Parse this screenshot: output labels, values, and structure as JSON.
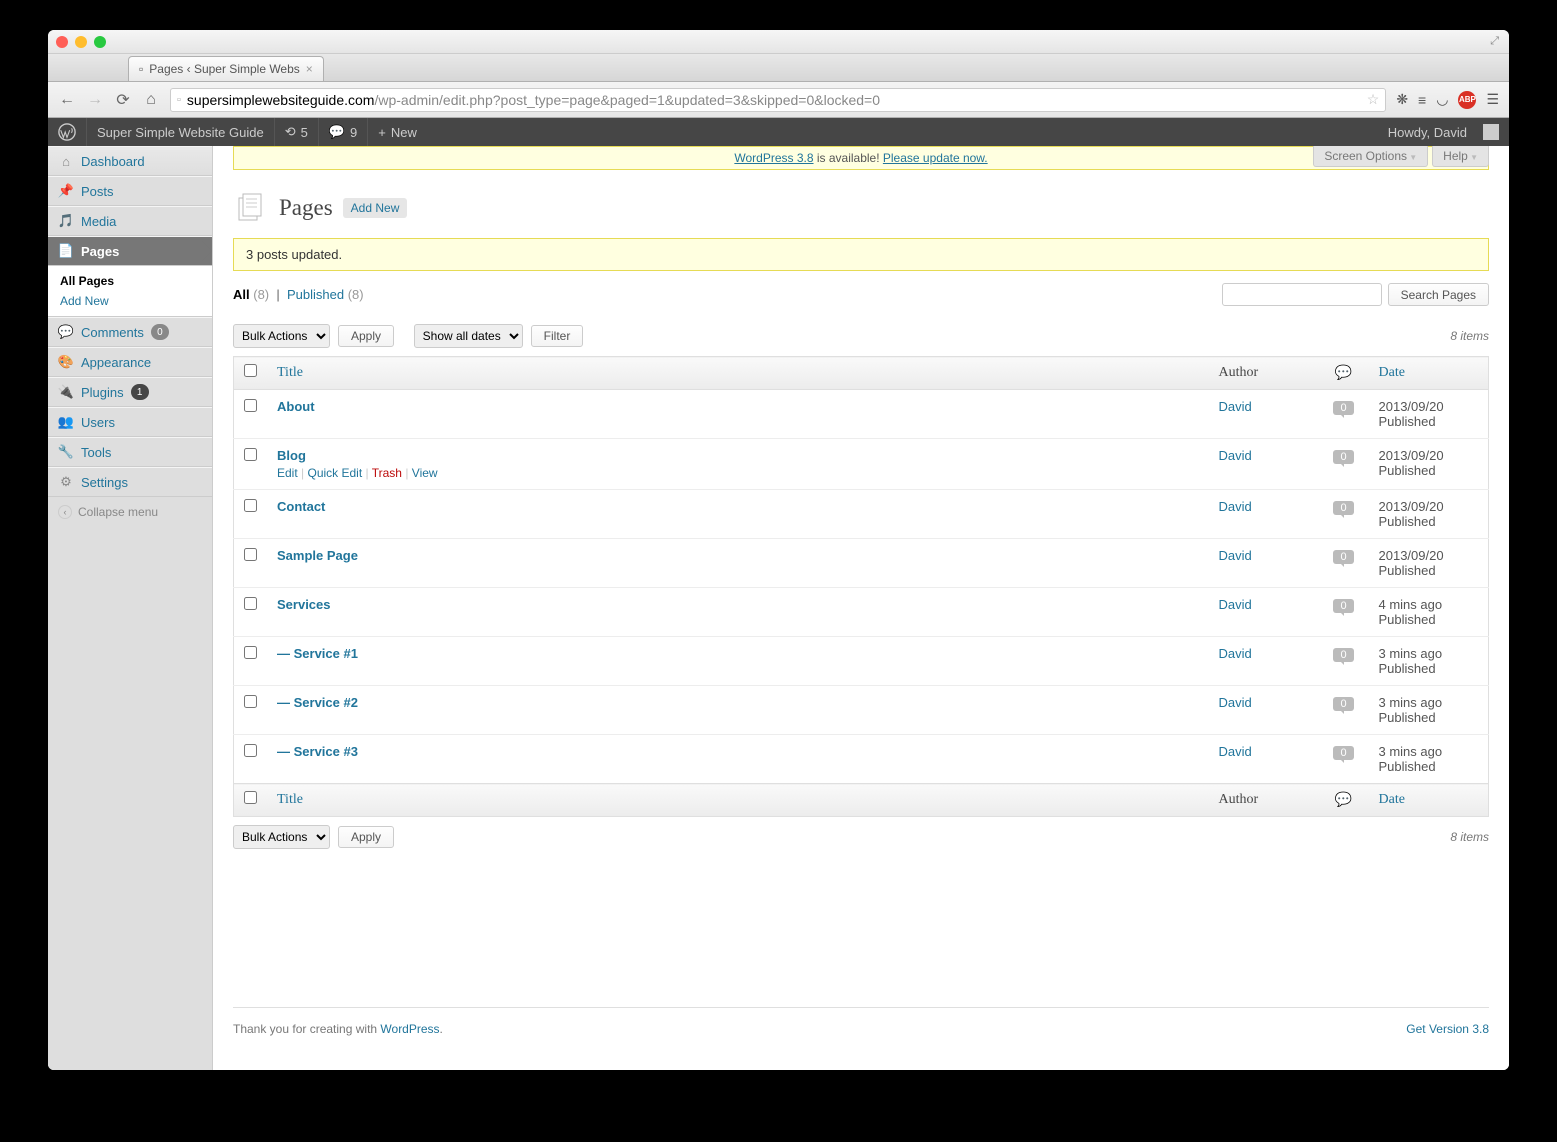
{
  "browser": {
    "tab_title": "Pages ‹ Super Simple Webs",
    "url_host": "supersimplewebsiteguide.com",
    "url_path": "/wp-admin/edit.php?post_type=page&paged=1&updated=3&skipped=0&locked=0"
  },
  "toolbar": {
    "site_name": "Super Simple Website Guide",
    "updates_count": "5",
    "comments_count": "9",
    "new_label": "New",
    "howdy": "Howdy, David"
  },
  "menu": {
    "dashboard": "Dashboard",
    "posts": "Posts",
    "media": "Media",
    "pages": "Pages",
    "pages_sub_all": "All Pages",
    "pages_sub_add": "Add New",
    "comments": "Comments",
    "comments_badge": "0",
    "appearance": "Appearance",
    "plugins": "Plugins",
    "plugins_badge": "1",
    "users": "Users",
    "tools": "Tools",
    "settings": "Settings",
    "collapse": "Collapse menu"
  },
  "update_nag": {
    "version_link": "WordPress 3.8",
    "mid": " is available! ",
    "action_link": "Please update now."
  },
  "screen_options": "Screen Options",
  "help": "Help",
  "heading": "Pages",
  "add_new": "Add New",
  "updated_msg": "3 posts updated.",
  "filters": {
    "all": "All",
    "all_count": "(8)",
    "published": "Published",
    "published_count": "(8)",
    "search_button": "Search Pages",
    "bulk_actions": "Bulk Actions",
    "apply": "Apply",
    "show_dates": "Show all dates",
    "filter": "Filter",
    "items_count": "8 items"
  },
  "columns": {
    "title": "Title",
    "author": "Author",
    "date": "Date"
  },
  "row_actions": {
    "edit": "Edit",
    "quick_edit": "Quick Edit",
    "trash": "Trash",
    "view": "View"
  },
  "rows": [
    {
      "title": "About",
      "author": "David",
      "comments": "0",
      "date": "2013/09/20",
      "status": "Published",
      "show_actions": false
    },
    {
      "title": "Blog",
      "author": "David",
      "comments": "0",
      "date": "2013/09/20",
      "status": "Published",
      "show_actions": true
    },
    {
      "title": "Contact",
      "author": "David",
      "comments": "0",
      "date": "2013/09/20",
      "status": "Published",
      "show_actions": false
    },
    {
      "title": "Sample Page",
      "author": "David",
      "comments": "0",
      "date": "2013/09/20",
      "status": "Published",
      "show_actions": false
    },
    {
      "title": "Services",
      "author": "David",
      "comments": "0",
      "date": "4 mins ago",
      "status": "Published",
      "show_actions": false
    },
    {
      "title": "— Service #1",
      "author": "David",
      "comments": "0",
      "date": "3 mins ago",
      "status": "Published",
      "show_actions": false
    },
    {
      "title": "— Service #2",
      "author": "David",
      "comments": "0",
      "date": "3 mins ago",
      "status": "Published",
      "show_actions": false
    },
    {
      "title": "— Service #3",
      "author": "David",
      "comments": "0",
      "date": "3 mins ago",
      "status": "Published",
      "show_actions": false
    }
  ],
  "footer": {
    "thanks_pre": "Thank you for creating with ",
    "thanks_link": "WordPress",
    "version": "Get Version 3.8"
  }
}
